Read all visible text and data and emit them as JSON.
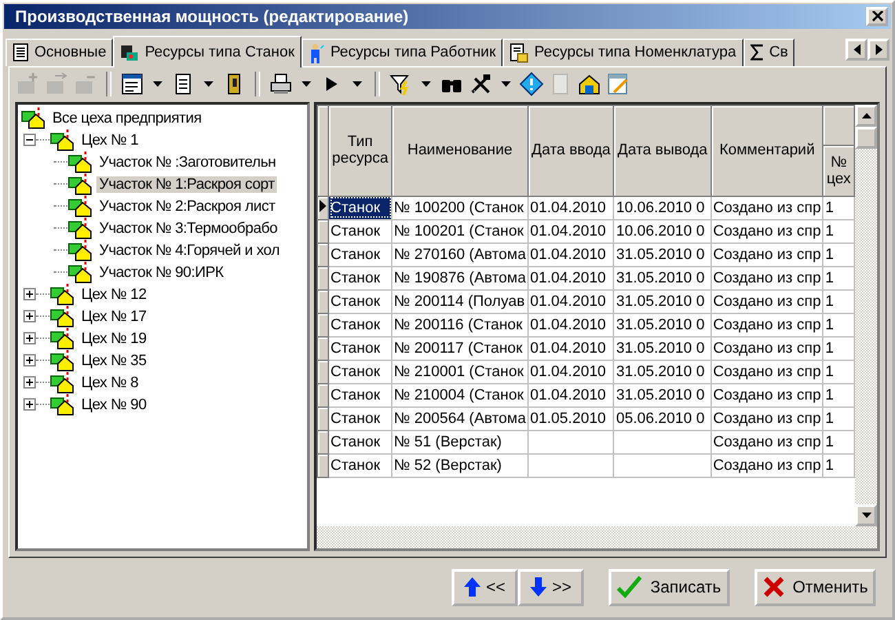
{
  "window": {
    "title": "Производственная мощность (редактирование)"
  },
  "tabs": [
    {
      "label": "Основные",
      "selected": false
    },
    {
      "label": "Ресурсы типа Станок",
      "selected": true
    },
    {
      "label": "Ресурсы типа Работник",
      "selected": false
    },
    {
      "label": "Ресурсы типа Номенклатура",
      "selected": false
    },
    {
      "label": "Св",
      "selected": false
    }
  ],
  "toolbar": [
    {
      "kind": "add",
      "disabled": true
    },
    {
      "kind": "move",
      "disabled": true
    },
    {
      "kind": "remove",
      "disabled": true
    },
    {
      "kind": "sep"
    },
    {
      "kind": "list",
      "disabled": false
    },
    {
      "kind": "caret"
    },
    {
      "kind": "page",
      "disabled": false
    },
    {
      "kind": "caret"
    },
    {
      "kind": "exit",
      "disabled": false
    },
    {
      "kind": "sep"
    },
    {
      "kind": "printer",
      "disabled": false
    },
    {
      "kind": "caret"
    },
    {
      "kind": "play",
      "disabled": false
    },
    {
      "kind": "caret"
    },
    {
      "kind": "sep"
    },
    {
      "kind": "filter",
      "disabled": false
    },
    {
      "kind": "caret"
    },
    {
      "kind": "binoculars",
      "disabled": false
    },
    {
      "kind": "tools",
      "disabled": false
    },
    {
      "kind": "caret"
    },
    {
      "kind": "info",
      "disabled": false
    },
    {
      "kind": "blank",
      "disabled": true
    },
    {
      "kind": "house",
      "disabled": false
    },
    {
      "kind": "notepad",
      "disabled": false
    }
  ],
  "tree": [
    {
      "label": "Все цеха предприятия",
      "selected": false,
      "children": [
        {
          "label": "Цех № 1",
          "selected": false,
          "expanded": true,
          "children": [
            {
              "label": "Участок № :Заготовительн",
              "selected": false
            },
            {
              "label": "Участок № 1:Раскроя сорт",
              "selected": true
            },
            {
              "label": "Участок № 2:Раскроя лист",
              "selected": false
            },
            {
              "label": "Участок № 3:Термообрабо",
              "selected": false
            },
            {
              "label": "Участок № 4:Горячей и хол",
              "selected": false
            },
            {
              "label": "Участок № 90:ИРК",
              "selected": false
            }
          ]
        },
        {
          "label": "Цех № 12",
          "selected": false,
          "expanded": false
        },
        {
          "label": "Цех № 17",
          "selected": false,
          "expanded": false
        },
        {
          "label": "Цех № 19",
          "selected": false,
          "expanded": false
        },
        {
          "label": "Цех № 35",
          "selected": false,
          "expanded": false
        },
        {
          "label": "Цех № 8",
          "selected": false,
          "expanded": false
        },
        {
          "label": "Цех № 90",
          "selected": false,
          "expanded": false
        }
      ]
    }
  ],
  "table": {
    "columns": [
      "Тип ресурса",
      "Наименование",
      "Дата ввода",
      "Дата вывода",
      "Комментарий",
      "№ цех"
    ],
    "rows": [
      {
        "selected": true,
        "cells": [
          "Станок",
          "№ 100200 (Станок",
          "01.04.2010",
          "10.06.2010 0",
          "Создано из спр",
          "1"
        ]
      },
      {
        "selected": false,
        "cells": [
          "Станок",
          "№ 100201 (Станок",
          "01.04.2010",
          "10.06.2010 0",
          "Создано из спр",
          "1"
        ]
      },
      {
        "selected": false,
        "cells": [
          "Станок",
          "№ 270160 (Автома",
          "01.04.2010",
          "31.05.2010 0",
          "Создано из спр",
          "1"
        ]
      },
      {
        "selected": false,
        "cells": [
          "Станок",
          "№ 190876 (Автома",
          "01.04.2010",
          "31.05.2010 0",
          "Создано из спр",
          "1"
        ]
      },
      {
        "selected": false,
        "cells": [
          "Станок",
          "№ 200114 (Полуав",
          "01.04.2010",
          "31.05.2010 0",
          "Создано из спр",
          "1"
        ]
      },
      {
        "selected": false,
        "cells": [
          "Станок",
          "№ 200116 (Станок",
          "01.04.2010",
          "31.05.2010 0",
          "Создано из спр",
          "1"
        ]
      },
      {
        "selected": false,
        "cells": [
          "Станок",
          "№ 200117 (Станок",
          "01.04.2010",
          "31.05.2010 0",
          "Создано из спр",
          "1"
        ]
      },
      {
        "selected": false,
        "cells": [
          "Станок",
          "№ 210001 (Станок",
          "01.04.2010",
          "31.05.2010 0",
          "Создано из спр",
          "1"
        ]
      },
      {
        "selected": false,
        "cells": [
          "Станок",
          "№ 210004 (Станок",
          "01.04.2010",
          "31.05.2010 0",
          "Создано из спр",
          "1"
        ]
      },
      {
        "selected": false,
        "cells": [
          "Станок",
          "№ 200564 (Автома",
          "01.05.2010",
          "05.06.2010 0",
          "Создано из спр",
          "1"
        ]
      },
      {
        "selected": false,
        "cells": [
          "Станок",
          "№ 51 (Верстак)",
          "",
          "",
          "Создано из спр",
          "1"
        ]
      },
      {
        "selected": false,
        "cells": [
          "Станок",
          "№ 52 (Верстак)",
          "",
          "",
          "Создано из спр",
          "1"
        ]
      }
    ]
  },
  "buttons": [
    {
      "kind": "up",
      "label": "<<"
    },
    {
      "kind": "down",
      "label": ">>"
    },
    {
      "kind": "save",
      "label": "Записать"
    },
    {
      "kind": "cancel",
      "label": "Отменить"
    }
  ]
}
